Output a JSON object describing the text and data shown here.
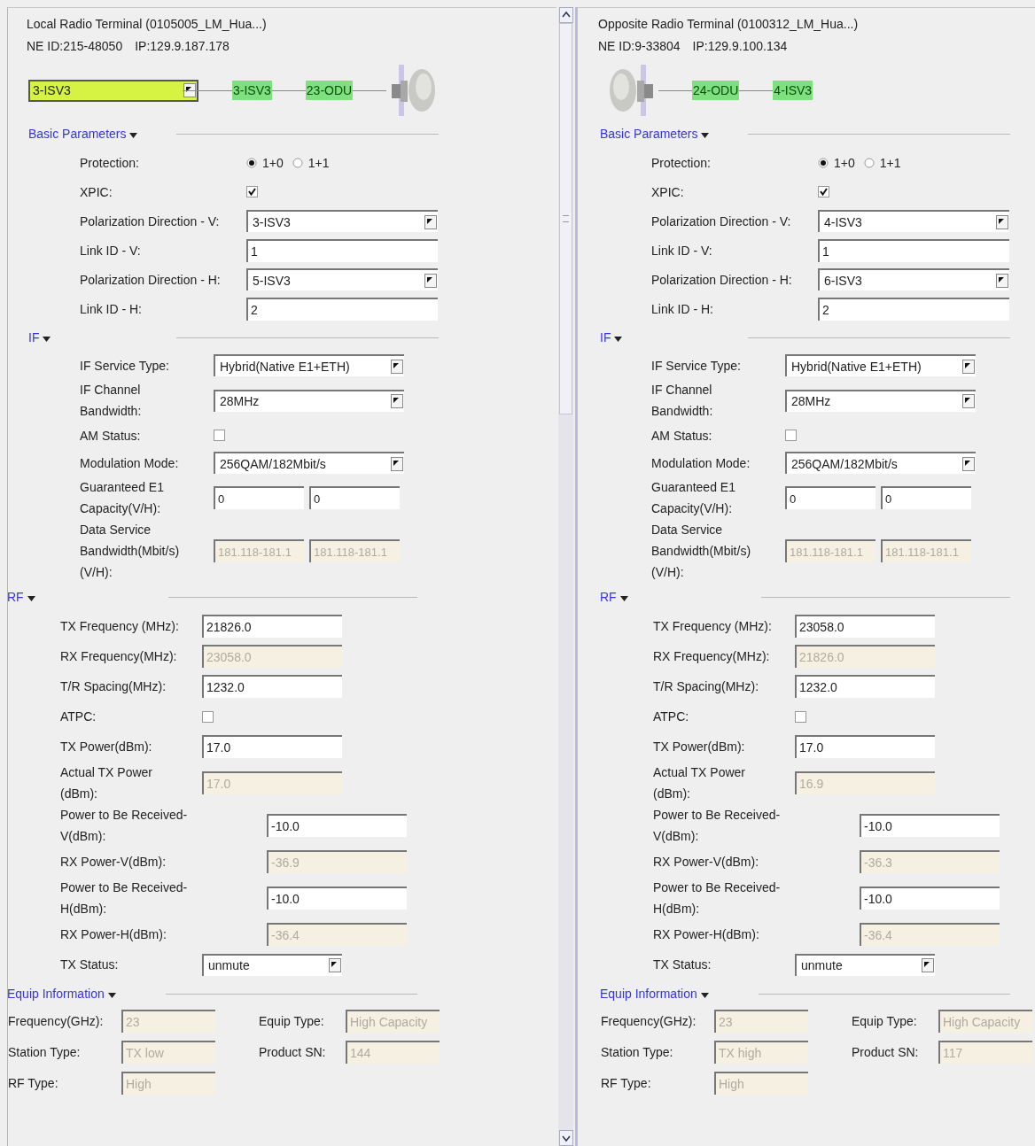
{
  "panels": [
    {
      "title": "Local Radio Terminal (0105005_LM_Hua...)",
      "ne_id": "NE ID:215-48050",
      "ip": "IP:129.9.187.178",
      "chain": [
        {
          "kind": "select",
          "value": "3-ISV3"
        },
        {
          "kind": "node",
          "label": "3-ISV3"
        },
        {
          "kind": "node",
          "label": "23-ODU"
        },
        {
          "kind": "antenna"
        }
      ],
      "sections": [
        {
          "title": "Basic Parameters",
          "kind": "form",
          "rows": [
            {
              "kind": "radio",
              "label": "Protection:",
              "options": [
                {
                  "label": "1+0",
                  "selected": true
                },
                {
                  "label": "1+1",
                  "selected": false
                }
              ]
            },
            {
              "kind": "checkbox",
              "label": "XPIC:",
              "checked": true
            },
            {
              "kind": "select",
              "label": "Polarization Direction - V:",
              "value": "3-ISV3"
            },
            {
              "kind": "input",
              "label": "Link ID - V:",
              "value": "1",
              "disabled": false
            },
            {
              "kind": "select",
              "label": "Polarization Direction - H:",
              "value": "5-ISV3"
            },
            {
              "kind": "input",
              "label": "Link ID - H:",
              "value": "2",
              "disabled": false
            }
          ]
        },
        {
          "title": "IF",
          "kind": "form",
          "rows": [
            {
              "kind": "select",
              "label": "IF Service Type:",
              "value": "Hybrid(Native E1+ETH)"
            },
            {
              "kind": "select",
              "label": "IF Channel Bandwidth:",
              "value": "28MHz"
            },
            {
              "kind": "checkbox",
              "label": "AM Status:",
              "checked": false
            },
            {
              "kind": "select",
              "label": "Modulation Mode:",
              "value": "256QAM/182Mbit/s"
            },
            {
              "kind": "pair",
              "label": "Guaranteed E1 Capacity(V/H):",
              "fields": [
                {
                  "value": "0",
                  "disabled": false
                },
                {
                  "value": "0",
                  "disabled": false
                }
              ]
            },
            {
              "kind": "pair",
              "label": "Data Service Bandwidth(Mbit/s) (V/H):",
              "fields": [
                {
                  "value": "181.118-181.1",
                  "disabled": true
                },
                {
                  "value": "181.118-181.1",
                  "disabled": true
                }
              ]
            }
          ]
        },
        {
          "title": "RF",
          "kind": "form",
          "rows": [
            {
              "kind": "input",
              "label": "TX Frequency (MHz):",
              "value": "21826.0",
              "disabled": false
            },
            {
              "kind": "input",
              "label": "RX Frequency(MHz):",
              "value": "23058.0",
              "disabled": true
            },
            {
              "kind": "input",
              "label": "T/R Spacing(MHz):",
              "value": "1232.0",
              "disabled": false
            },
            {
              "kind": "checkbox",
              "label": "ATPC:",
              "checked": false
            },
            {
              "kind": "input",
              "label": "TX Power(dBm):",
              "value": "17.0",
              "disabled": false
            },
            {
              "kind": "input",
              "label": "Actual TX Power (dBm):",
              "value": "17.0",
              "disabled": true
            },
            {
              "kind": "input",
              "label": "Power to Be Received-V(dBm):",
              "value": "-10.0",
              "disabled": false
            },
            {
              "kind": "input",
              "label": "RX Power-V(dBm):",
              "value": "-36.9",
              "disabled": true
            },
            {
              "kind": "input",
              "label": "Power to Be Received-H(dBm):",
              "value": "-10.0",
              "disabled": false
            },
            {
              "kind": "input",
              "label": "RX Power-H(dBm):",
              "value": "-36.4",
              "disabled": true
            },
            {
              "kind": "select",
              "label": "TX Status:",
              "value": "unmute"
            }
          ]
        },
        {
          "title": "Equip Information",
          "kind": "grid",
          "items": [
            {
              "label": "Frequency(GHz):",
              "value": "23",
              "disabled": true
            },
            {
              "label": "Equip Type:",
              "value": "High Capacity",
              "disabled": true
            },
            {
              "label": "Station Type:",
              "value": "TX low",
              "disabled": true
            },
            {
              "label": "Product SN:",
              "value": "144",
              "disabled": true
            },
            {
              "label": "RF Type:",
              "value": "High",
              "disabled": true
            }
          ]
        }
      ]
    },
    {
      "title": "Opposite Radio Terminal (0100312_LM_Hua...)",
      "ne_id": "NE ID:9-33804",
      "ip": "IP:129.9.100.134",
      "chain": [
        {
          "kind": "antenna"
        },
        {
          "kind": "node",
          "label": "24-ODU"
        },
        {
          "kind": "node",
          "label": "4-ISV3"
        }
      ],
      "sections": [
        {
          "title": "Basic Parameters",
          "kind": "form",
          "rows": [
            {
              "kind": "radio",
              "label": "Protection:",
              "options": [
                {
                  "label": "1+0",
                  "selected": true
                },
                {
                  "label": "1+1",
                  "selected": false
                }
              ]
            },
            {
              "kind": "checkbox",
              "label": "XPIC:",
              "checked": true
            },
            {
              "kind": "select",
              "label": "Polarization Direction - V:",
              "value": "4-ISV3"
            },
            {
              "kind": "input",
              "label": "Link ID - V:",
              "value": "1",
              "disabled": false
            },
            {
              "kind": "select",
              "label": "Polarization Direction - H:",
              "value": "6-ISV3"
            },
            {
              "kind": "input",
              "label": "Link ID - H:",
              "value": "2",
              "disabled": false
            }
          ]
        },
        {
          "title": "IF",
          "kind": "form",
          "rows": [
            {
              "kind": "select",
              "label": "IF Service Type:",
              "value": "Hybrid(Native E1+ETH)"
            },
            {
              "kind": "select",
              "label": "IF Channel Bandwidth:",
              "value": "28MHz"
            },
            {
              "kind": "checkbox",
              "label": "AM Status:",
              "checked": false
            },
            {
              "kind": "select",
              "label": "Modulation Mode:",
              "value": "256QAM/182Mbit/s"
            },
            {
              "kind": "pair",
              "label": "Guaranteed E1 Capacity(V/H):",
              "fields": [
                {
                  "value": "0",
                  "disabled": false
                },
                {
                  "value": "0",
                  "disabled": false
                }
              ]
            },
            {
              "kind": "pair",
              "label": "Data Service Bandwidth(Mbit/s) (V/H):",
              "fields": [
                {
                  "value": "181.118-181.1",
                  "disabled": true
                },
                {
                  "value": "181.118-181.1",
                  "disabled": true
                }
              ]
            }
          ]
        },
        {
          "title": "RF",
          "kind": "form",
          "rows": [
            {
              "kind": "input",
              "label": "TX Frequency (MHz):",
              "value": "23058.0",
              "disabled": false
            },
            {
              "kind": "input",
              "label": "RX Frequency(MHz):",
              "value": "21826.0",
              "disabled": true
            },
            {
              "kind": "input",
              "label": "T/R Spacing(MHz):",
              "value": "1232.0",
              "disabled": false
            },
            {
              "kind": "checkbox",
              "label": "ATPC:",
              "checked": false
            },
            {
              "kind": "input",
              "label": "TX Power(dBm):",
              "value": "17.0",
              "disabled": false
            },
            {
              "kind": "input",
              "label": "Actual TX Power (dBm):",
              "value": "16.9",
              "disabled": true
            },
            {
              "kind": "input",
              "label": "Power to Be Received-V(dBm):",
              "value": "-10.0",
              "disabled": false
            },
            {
              "kind": "input",
              "label": "RX Power-V(dBm):",
              "value": "-36.3",
              "disabled": true
            },
            {
              "kind": "input",
              "label": "Power to Be Received-H(dBm):",
              "value": "-10.0",
              "disabled": false
            },
            {
              "kind": "input",
              "label": "RX Power-H(dBm):",
              "value": "-36.4",
              "disabled": true
            },
            {
              "kind": "select",
              "label": "TX Status:",
              "value": "unmute"
            }
          ]
        },
        {
          "title": "Equip Information",
          "kind": "grid",
          "items": [
            {
              "label": "Frequency(GHz):",
              "value": "23",
              "disabled": true
            },
            {
              "label": "Equip Type:",
              "value": "High Capacity",
              "disabled": true
            },
            {
              "label": "Station Type:",
              "value": "TX high",
              "disabled": true
            },
            {
              "label": "Product SN:",
              "value": "117",
              "disabled": true
            },
            {
              "label": "RF Type:",
              "value": "High",
              "disabled": true
            }
          ]
        }
      ]
    }
  ]
}
